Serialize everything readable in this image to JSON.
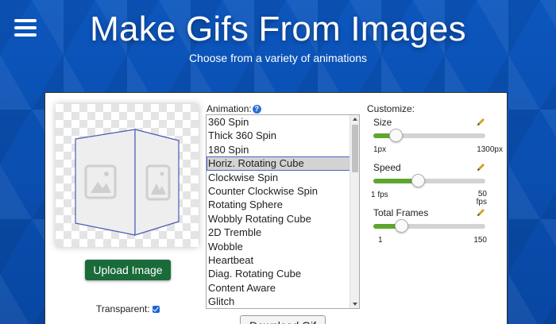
{
  "header": {
    "title": "Make Gifs From Images",
    "subtitle": "Choose from a variety of animations"
  },
  "left": {
    "upload_label": "Upload Image",
    "transparent_label": "Transparent:",
    "transparent_checked": true
  },
  "animation": {
    "label": "Animation:",
    "help_glyph": "?",
    "items": [
      "360 Spin",
      "Thick 360 Spin",
      "180 Spin",
      "Horiz. Rotating Cube",
      "Clockwise Spin",
      "Counter Clockwise Spin",
      "Rotating Sphere",
      "Wobbly Rotating Cube",
      "2D Tremble",
      "Wobble",
      "Heartbeat",
      "Diag. Rotating Cube",
      "Content Aware",
      "Glitch"
    ],
    "selected": "Horiz. Rotating Cube",
    "download_label": "Download Gif"
  },
  "customize": {
    "label": "Customize:",
    "size": {
      "name": "Size",
      "min": "1px",
      "max": "1300px",
      "value_fraction": 0.2
    },
    "speed": {
      "name": "Speed",
      "min": "1 fps",
      "max_line1": "50",
      "max_line2": "fps",
      "value_fraction": 0.4
    },
    "frames": {
      "name": "Total Frames",
      "min": "1",
      "max": "150",
      "value_fraction": 0.25
    }
  },
  "icons": {
    "menu": "hamburger-menu-icon",
    "help": "question-circle-icon",
    "edit": "pencil-icon",
    "image": "image-placeholder-icon"
  },
  "colors": {
    "background": "#0a4fb0",
    "upload_button": "#1a6b3a",
    "slider_fill": "#5fa62e",
    "selection_outline": "#4a66c4"
  }
}
